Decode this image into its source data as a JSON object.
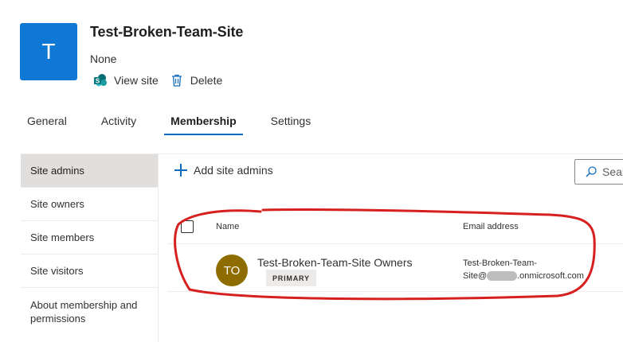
{
  "site": {
    "tile_letter": "T",
    "title": "Test-Broken-Team-Site",
    "description": "None",
    "actions": [
      {
        "label": "View site",
        "icon": "sharepoint-icon"
      },
      {
        "label": "Delete",
        "icon": "trash-icon"
      }
    ]
  },
  "tabs": [
    {
      "label": "General",
      "active": false
    },
    {
      "label": "Activity",
      "active": false
    },
    {
      "label": "Membership",
      "active": true
    },
    {
      "label": "Settings",
      "active": false
    }
  ],
  "left_nav": [
    {
      "label": "Site admins",
      "active": true
    },
    {
      "label": "Site owners",
      "active": false
    },
    {
      "label": "Site members",
      "active": false
    },
    {
      "label": "Site visitors",
      "active": false
    },
    {
      "label": "About membership and permissions",
      "active": false
    }
  ],
  "toolbar": {
    "add_label": "Add site admins",
    "search_placeholder": "Sear"
  },
  "table": {
    "columns": [
      "Name",
      "Email address"
    ],
    "rows": [
      {
        "initials": "TO",
        "name": "Test-Broken-Team-Site Owners",
        "badge": "PRIMARY",
        "email_line1": "Test-Broken-Team-",
        "email_prefix": "Site@",
        "email_suffix": ".onmicrosoft.com"
      }
    ]
  },
  "colors": {
    "tile": "#0f78d4",
    "accent": "#0f6cbd",
    "avatar": "#8f6c00",
    "annotation": "#d6201f"
  }
}
